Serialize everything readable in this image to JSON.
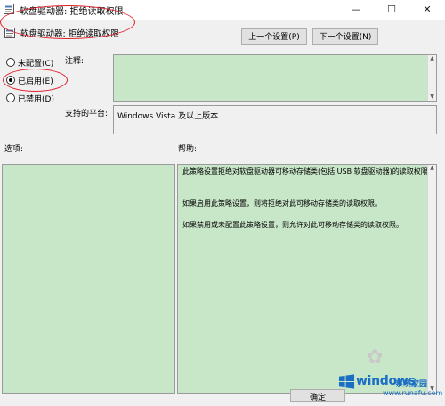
{
  "window": {
    "title": "软盘驱动器: 拒绝读取权限",
    "minimize_glyph": "—",
    "maximize_glyph": "☐",
    "close_glyph": "✕"
  },
  "header": {
    "policy_name": "软盘驱动器: 拒绝读取权限",
    "prev_button": "上一个设置(P)",
    "next_button": "下一个设置(N)"
  },
  "radios": [
    {
      "label": "未配置(C)",
      "checked": false
    },
    {
      "label": "已启用(E)",
      "checked": true
    },
    {
      "label": "已禁用(D)",
      "checked": false
    }
  ],
  "comment": {
    "label": "注释:",
    "value": ""
  },
  "platform": {
    "label": "支持的平台:",
    "value": "Windows Vista 及以上版本"
  },
  "options": {
    "label": "选项:"
  },
  "help": {
    "label": "帮助:",
    "paragraphs": [
      "此策略设置拒绝对软盘驱动器可移动存储类(包括 USB 软盘驱动器)的读取权限。",
      "如果启用此策略设置，则将拒绝对此可移动存储类的读取权限。",
      "如果禁用或未配置此策略设置，则允许对此可移动存储类的读取权限。"
    ]
  },
  "footer": {
    "ok_button": "确定"
  },
  "watermark": {
    "brand": "windows",
    "brand_cn": "系统家园",
    "url": "www.runafu.com"
  },
  "colors": {
    "pane_green": "#c8e6c8",
    "annotation_red": "#e3202a",
    "brand_blue": "#1a6fc4"
  },
  "icons": {
    "title": "policy-window-icon",
    "policy": "policy-setting-icon"
  }
}
